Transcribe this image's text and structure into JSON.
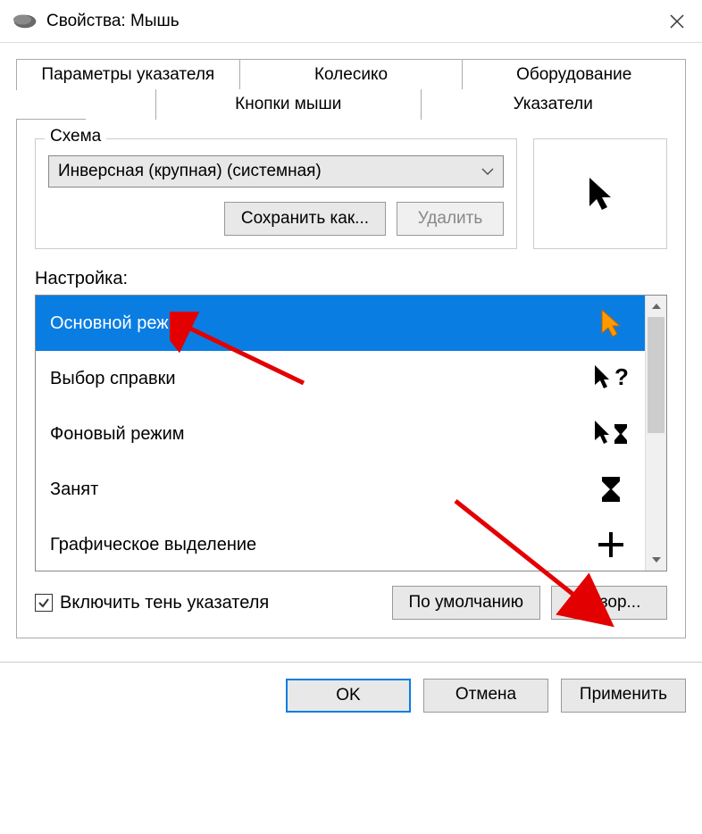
{
  "titlebar": {
    "title": "Свойства: Мышь"
  },
  "tabs": {
    "row1": [
      "Параметры указателя",
      "Колесико",
      "Оборудование"
    ],
    "row2": [
      "Кнопки мыши",
      "Указатели"
    ]
  },
  "scheme": {
    "legend": "Схема",
    "selected": "Инверсная (крупная) (системная)",
    "save_button": "Сохранить как...",
    "delete_button": "Удалить"
  },
  "settings": {
    "label": "Настройка:",
    "items": [
      {
        "label": "Основной режим",
        "icon": "pointer-orange"
      },
      {
        "label": "Выбор справки",
        "icon": "pointer-help"
      },
      {
        "label": "Фоновый режим",
        "icon": "pointer-busy"
      },
      {
        "label": "Занят",
        "icon": "hourglass"
      },
      {
        "label": "Графическое выделение",
        "icon": "crosshair"
      }
    ]
  },
  "shadow_checkbox": {
    "label": "Включить тень указателя",
    "checked": true
  },
  "bottom_buttons": {
    "default": "По умолчанию",
    "browse": "Обзор..."
  },
  "dialog_buttons": {
    "ok": "OK",
    "cancel": "Отмена",
    "apply": "Применить"
  }
}
